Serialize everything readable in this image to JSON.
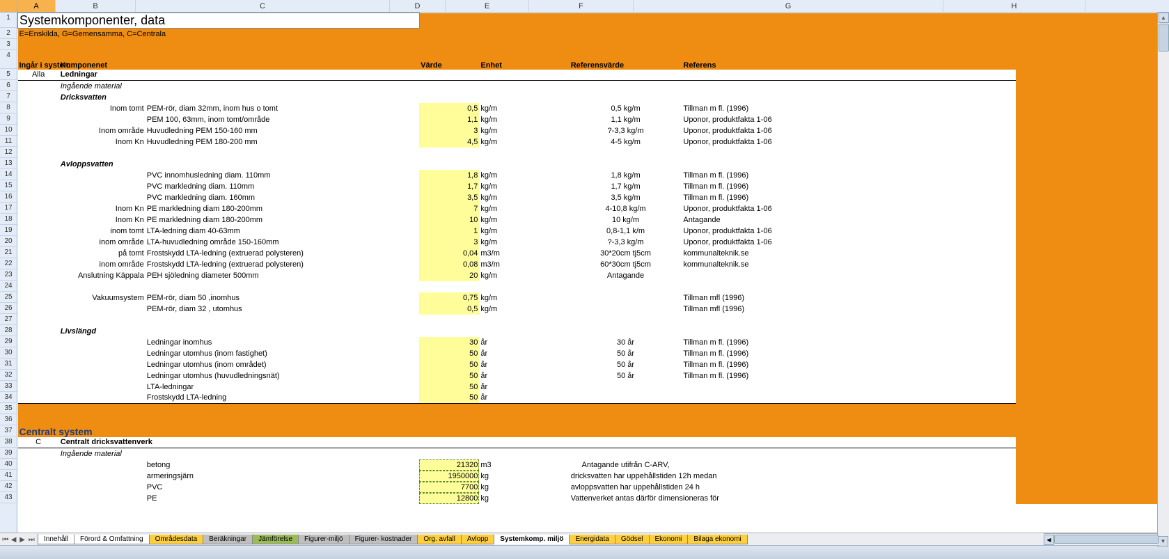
{
  "columns": [
    "A",
    "B",
    "C",
    "D",
    "E",
    "F",
    "G",
    "H"
  ],
  "title": "Systemkomponenter, data",
  "subtitle": "E=Enskilda, G=Gemensamma, C=Centrala",
  "headers": {
    "A": "Ingår i system",
    "B": "Komponenet",
    "D": "Värde",
    "E": "Enhet",
    "F": "Referensvärde",
    "G": "Referens"
  },
  "section1": {
    "A": "Alla",
    "B": "Ledningar"
  },
  "s1_sub": "Ingående material",
  "s1_dricks": "Dricksvatten",
  "rows_dricks": [
    {
      "B": "Inom tomt",
      "C": "PEM-rör, diam 32mm, inom hus o tomt",
      "D": "0,5",
      "E": "kg/m",
      "F": "0,5 kg/m",
      "G": "Tillman m fl. (1996)"
    },
    {
      "B": "",
      "C": "PEM 100, 63mm, inom tomt/område",
      "D": "1,1",
      "E": "kg/m",
      "F": "1,1 kg/m",
      "G": "Uponor, produktfakta 1-06"
    },
    {
      "B": "Inom område",
      "C": "Huvudledning PEM 150-160 mm",
      "D": "3",
      "E": "kg/m",
      "F": "?-3,3 kg/m",
      "G": "Uponor, produktfakta 1-06"
    },
    {
      "B": "Inom Kn",
      "C": "Huvudledning PEM 180-200 mm",
      "D": "4,5",
      "E": "kg/m",
      "F": "4-5 kg/m",
      "G": "Uponor, produktfakta 1-06"
    }
  ],
  "s1_avlopp": "Avloppsvatten",
  "rows_avlopp": [
    {
      "B": "",
      "C": "PVC innomhusledning diam. 110mm",
      "D": "1,8",
      "E": "kg/m",
      "F": "1,8 kg/m",
      "G": "Tillman m fl. (1996)"
    },
    {
      "B": "",
      "C": "PVC markledning diam. 110mm",
      "D": "1,7",
      "E": "kg/m",
      "F": "1,7 kg/m",
      "G": "Tillman m fl. (1996)"
    },
    {
      "B": "",
      "C": "PVC markledning diam. 160mm",
      "D": "3,5",
      "E": "kg/m",
      "F": "3,5 kg/m",
      "G": "Tillman m fl. (1996)"
    },
    {
      "B": "Inom Kn",
      "C": "PE markledning diam 180-200mm",
      "D": "7",
      "E": "kg/m",
      "F": "4-10,8 kg/m",
      "G": "Uponor, produktfakta 1-06"
    },
    {
      "B": "Inom Kn",
      "C": "PE markledning diam 180-200mm",
      "D": "10",
      "E": "kg/m",
      "F": "10 kg/m",
      "G": "Antagande"
    },
    {
      "B": "inom tomt",
      "C": "LTA-ledning diam 40-63mm",
      "D": "1",
      "E": "kg/m",
      "F": "0,8-1,1 k/m",
      "G": "Uponor, produktfakta 1-06"
    },
    {
      "B": "inom område",
      "C": "LTA-huvudledning område 150-160mm",
      "D": "3",
      "E": "kg/m",
      "F": "?-3,3 kg/m",
      "G": "Uponor, produktfakta 1-06"
    },
    {
      "B": "på tomt",
      "C": "Frostskydd LTA-ledning (extruerad polysteren)",
      "D": "0,04",
      "E": "m3/m",
      "F": "30*20cm tj5cm",
      "G": "kommunalteknik.se"
    },
    {
      "B": "inom område",
      "C": "Frostskydd LTA-ledning (extruerad polysteren)",
      "D": "0,08",
      "E": "m3/m",
      "F": "60*30cm tj5cm",
      "G": "kommunalteknik.se"
    },
    {
      "B": "Anslutning Käppala",
      "C": "PEH sjöledning diameter 500mm",
      "D": "20",
      "E": "kg/m",
      "F": "Antagande",
      "G": ""
    }
  ],
  "rows_vakuum": [
    {
      "B": "Vakuumsystem",
      "C": "PEM-rör, diam 50 ,inomhus",
      "D": "0,75",
      "E": "kg/m",
      "F": "",
      "G": "Tillman mfl (1996)"
    },
    {
      "B": "",
      "C": "PEM-rör, diam 32 , utomhus",
      "D": "0,5",
      "E": "kg/m",
      "F": "",
      "G": "Tillman mfl (1996)"
    }
  ],
  "s1_livs": "Livslängd",
  "rows_livs": [
    {
      "C": "Ledningar inomhus",
      "D": "30",
      "E": "år",
      "F": "30 år",
      "G": "Tillman m fl. (1996)"
    },
    {
      "C": "Ledningar utomhus (inom fastighet)",
      "D": "50",
      "E": "år",
      "F": "50 år",
      "G": "Tillman m fl. (1996)"
    },
    {
      "C": "Ledningar utomhus (inom området)",
      "D": "50",
      "E": "år",
      "F": "50 år",
      "G": "Tillman m fl. (1996)"
    },
    {
      "C": "Ledningar utomhus (huvudledningsnät)",
      "D": "50",
      "E": "år",
      "F": "50 år",
      "G": "Tillman m fl. (1996)"
    },
    {
      "C": "LTA-ledningar",
      "D": "50",
      "E": "år",
      "F": "",
      "G": ""
    },
    {
      "C": "Frostskydd LTA-ledning",
      "D": "50",
      "E": "år",
      "F": "",
      "G": ""
    }
  ],
  "section2_title": "Centralt system",
  "section2": {
    "A": "C",
    "B": "Centralt dricksvattenverk"
  },
  "s2_sub": "Ingående material",
  "rows_s2": [
    {
      "C": "betong",
      "D": "21320",
      "E": "m3",
      "F": "Antagande utifrån C-ARV,",
      "G": ""
    },
    {
      "C": "armeringsjärn",
      "D": "1950000",
      "E": "kg",
      "F": "dricksvatten har uppehållstiden 12h medan",
      "G": ""
    },
    {
      "C": "PVC",
      "D": "7700",
      "E": "kg",
      "F": "avloppsvatten har uppehållstiden 24 h",
      "G": ""
    },
    {
      "C": "PE",
      "D": "12800",
      "E": "kg",
      "F": "Vattenverket antas därför dimensioneras för",
      "G": ""
    }
  ],
  "tabs": [
    {
      "label": "Innehåll",
      "cls": ""
    },
    {
      "label": "Förord & Omfattning",
      "cls": ""
    },
    {
      "label": "Områdesdata",
      "cls": "yellow"
    },
    {
      "label": "Beräkningar",
      "cls": "grey"
    },
    {
      "label": "Jämförelse",
      "cls": "green"
    },
    {
      "label": "Figurer-miljö",
      "cls": "grey"
    },
    {
      "label": "Figurer- kostnader",
      "cls": "grey"
    },
    {
      "label": "Org. avfall",
      "cls": "yellow"
    },
    {
      "label": "Avlopp",
      "cls": "yellow"
    },
    {
      "label": "Systemkomp. miljö",
      "cls": "active"
    },
    {
      "label": "Energidata",
      "cls": "yellow"
    },
    {
      "label": "Gödsel",
      "cls": "yellow"
    },
    {
      "label": "Ekonomi",
      "cls": "yellow"
    },
    {
      "label": "Bilaga ekonomi",
      "cls": "yellow"
    }
  ]
}
